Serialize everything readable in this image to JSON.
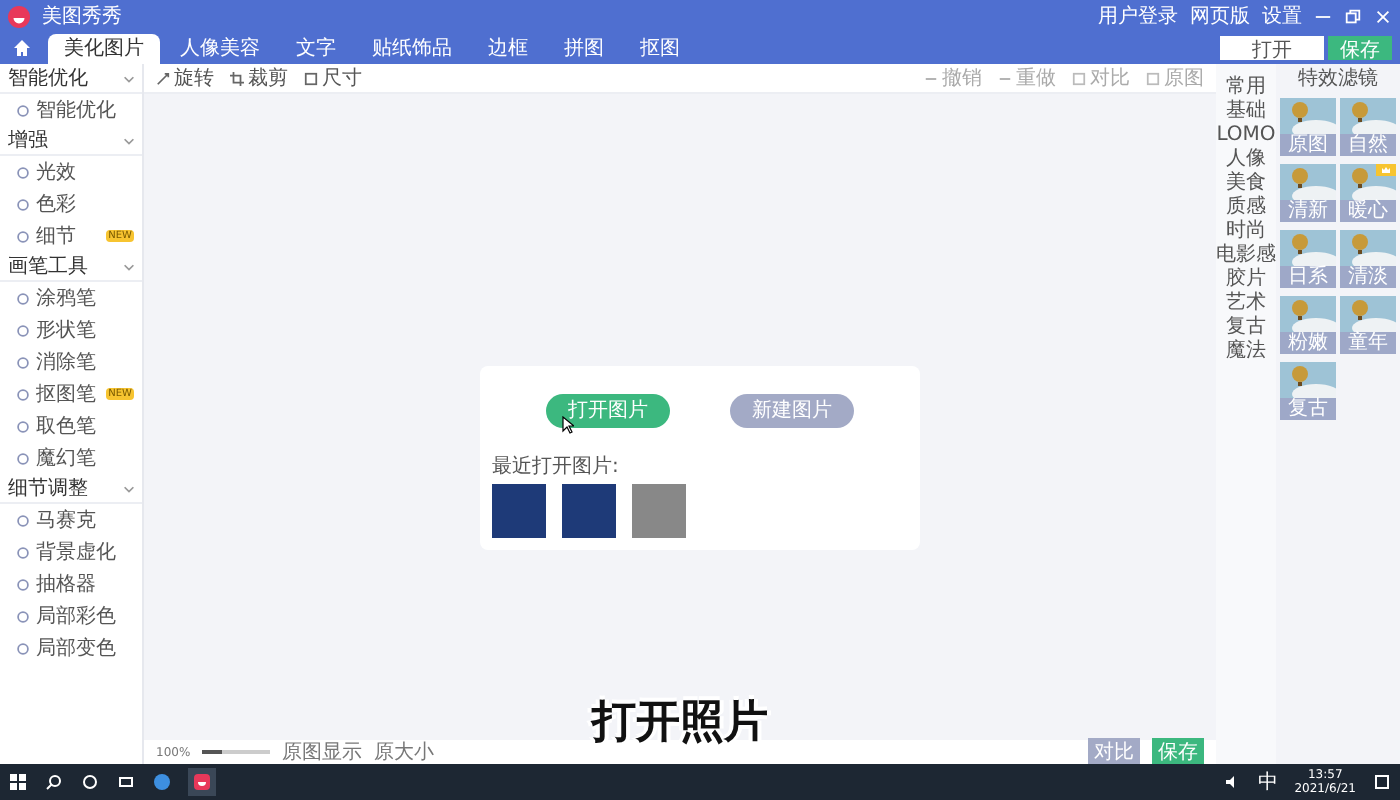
{
  "window": {
    "title": "美图秀秀",
    "actions": [
      "用户登录",
      "网页版",
      "设置"
    ]
  },
  "tabs": [
    {
      "label": "美化图片",
      "selected": true
    },
    {
      "label": "人像美容",
      "selected": false
    },
    {
      "label": "文字",
      "selected": false
    },
    {
      "label": "贴纸饰品",
      "selected": false
    },
    {
      "label": "边框",
      "selected": false
    },
    {
      "label": "拼图",
      "selected": false
    },
    {
      "label": "抠图",
      "selected": false
    }
  ],
  "header_buttons": {
    "open": "打开",
    "save": "保存"
  },
  "toolbar": {
    "left": [
      "旋转",
      "裁剪",
      "尺寸"
    ],
    "right": [
      "撤销",
      "重做",
      "对比",
      "原图"
    ]
  },
  "sidebar": {
    "sections": [
      {
        "title": "智能优化",
        "expanded": true,
        "items": [
          {
            "label": "智能优化"
          }
        ]
      },
      {
        "title": "增强",
        "expanded": true,
        "items": [
          {
            "label": "光效"
          },
          {
            "label": "色彩"
          },
          {
            "label": "细节",
            "badge": "NEW"
          }
        ]
      },
      {
        "title": "画笔工具",
        "expanded": true,
        "items": [
          {
            "label": "涂鸦笔"
          },
          {
            "label": "形状笔"
          },
          {
            "label": "消除笔"
          },
          {
            "label": "抠图笔",
            "badge": "NEW"
          },
          {
            "label": "取色笔"
          },
          {
            "label": "魔幻笔"
          }
        ]
      },
      {
        "title": "细节调整",
        "expanded": true,
        "items": [
          {
            "label": "马赛克"
          },
          {
            "label": "背景虚化"
          },
          {
            "label": "抽格器"
          },
          {
            "label": "局部彩色"
          },
          {
            "label": "局部变色"
          }
        ]
      }
    ]
  },
  "canvas": {
    "open_button": "打开图片",
    "new_button": "新建图片",
    "recent_label": "最近打开图片:"
  },
  "bottom_bar": {
    "zoom": "100%",
    "level": 0.3,
    "fit": "原图显示",
    "actual": "原大小",
    "compare": "对比",
    "save": "保存"
  },
  "filters": {
    "title": "特效滤镜",
    "categories": [
      "常用",
      "基础",
      "LOMO",
      "人像",
      "美食",
      "质感",
      "时尚",
      "电影感",
      "胶片",
      "艺术",
      "复古",
      "魔法"
    ],
    "thumbnails": [
      {
        "label": "原图"
      },
      {
        "label": "自然"
      },
      {
        "label": "清新"
      },
      {
        "label": "暖心",
        "vip": true
      },
      {
        "label": "日系"
      },
      {
        "label": "清淡"
      },
      {
        "label": "粉嫩"
      },
      {
        "label": "童年"
      },
      {
        "label": "复古"
      }
    ]
  },
  "video_caption": "打开照片",
  "taskbar": {
    "ime": "中",
    "time": "13:57",
    "date": "2021/6/21"
  }
}
